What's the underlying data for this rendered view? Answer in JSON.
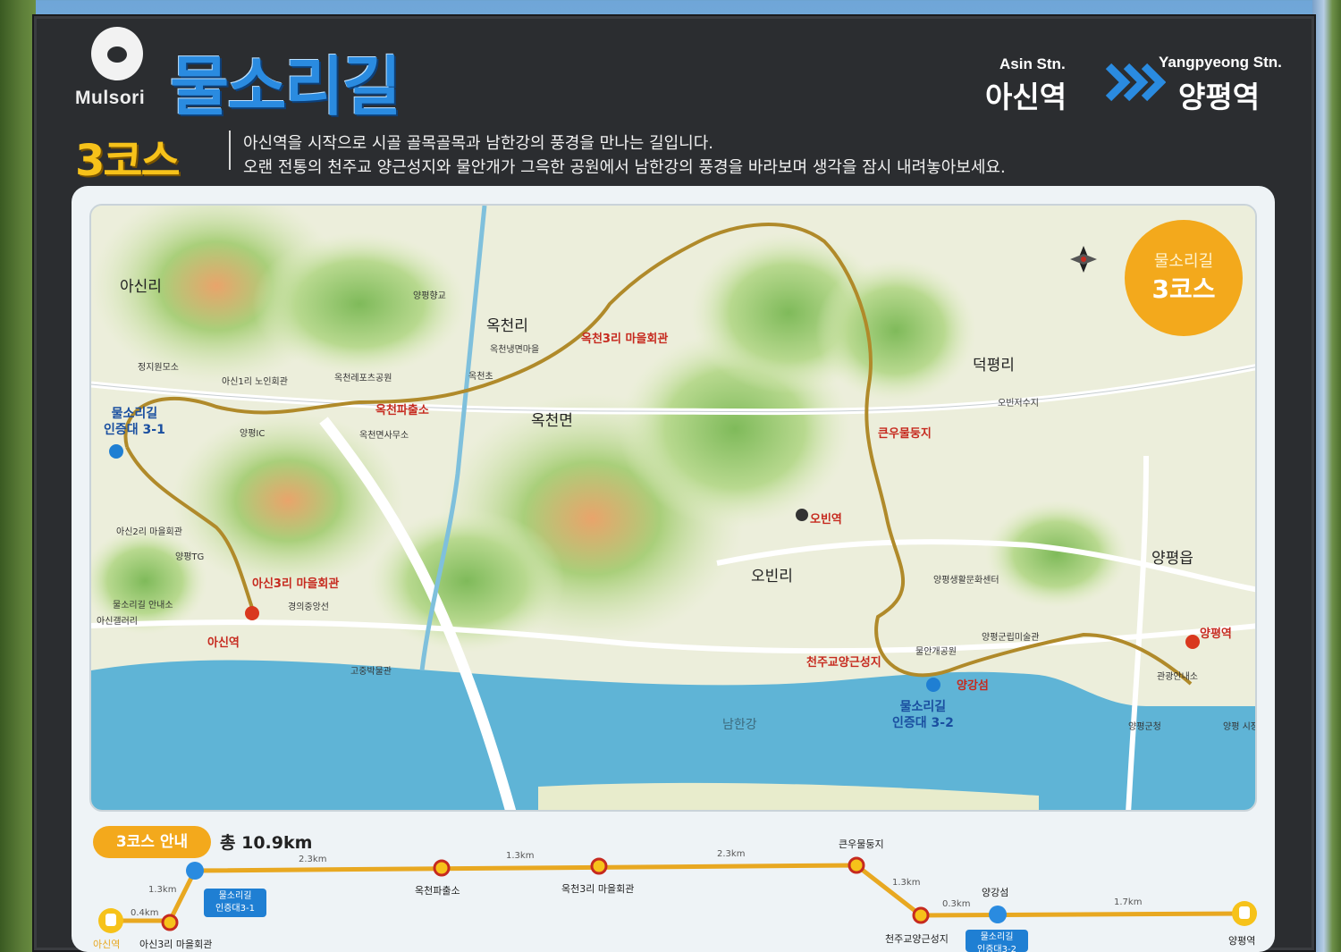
{
  "header": {
    "logo_text": "Mulsori",
    "title": "물소리길",
    "course": "3코스",
    "from_en": "Asin Stn.",
    "from_ko": "아신역",
    "to_en": "Yangpyeong Stn.",
    "to_ko": "양평역",
    "desc_line1": "아신역을 시작으로 시골 골목골목과 남한강의 풍경을 만나는 길입니다.",
    "desc_line2": "오랜 전통의 천주교 양근성지와 물안개가 그윽한 공원에서 남한강의 풍경을 바라보며 생각을 잠시 내려놓아보세요."
  },
  "colors": {
    "board": "#2b2d30",
    "title_blue": "#2a8be0",
    "course_yellow": "#f6c21a",
    "trail": "#b08a2a",
    "river": "#5fb4d6",
    "badge": "#f3a91c",
    "station_red": "#d9381e"
  },
  "map": {
    "badge_line1": "물소리길",
    "badge_line2": "3코스",
    "towns": {
      "asinri": "아신리",
      "okcheonri": "옥천리",
      "okcheonmyeon": "옥천면",
      "deokpyeongri": "덕평리",
      "obinri": "오빈리",
      "yangpyeongeup": "양평읍"
    },
    "river_name": "남한강",
    "red_labels": {
      "okcheon_police": "옥천파출소",
      "okcheon3ri_hall": "옥천3리 마을회관",
      "keunu_pond": "큰우물둥지",
      "asin3ri_hall": "아신3리 마을회관",
      "asin_station": "아신역",
      "catholic_shrine": "천주교양근성지",
      "yangpyeong_station": "양평역",
      "obin_station": "오빈역",
      "yanggang_island": "양강섬"
    },
    "cert_1_line1": "물소리길",
    "cert_1_line2": "인증대 3-1",
    "cert_2_line1": "물소리길",
    "cert_2_line2": "인증대 3-2",
    "small_labels": {
      "jeongji": "정지원모소",
      "asin1ri": "아신1리 노인회관",
      "okcheon_sports": "옥천레포츠공원",
      "okcheon_office": "옥천면사무소",
      "okcheon_naengmyeon": "옥천냉면마을",
      "okcheon_elem": "옥천초",
      "yangpyeong_ic": "양평IC",
      "asin2ri": "아신2리 마을회관",
      "yangpyeong_tg": "양평TG",
      "mulsori_info": "물소리길 안내소",
      "asin_cafe": "아신갤러리",
      "gyeongui_line": "경의중앙선",
      "yangpyeong_center": "양평생활문화센터",
      "yangpyeong_museum": "양평군립미술관",
      "mulangae_park": "물안개공원",
      "tourist_info": "관광안내소",
      "yangpyeong_market": "양평 시장",
      "yangpyeong_office": "양평군청",
      "gojung": "고중박물관",
      "obin_reservoir": "오빈저수지",
      "yangpyeong_school": "양평향교"
    }
  },
  "strip": {
    "pill": "3코스 안내",
    "total": "총 10.9km",
    "stops": [
      {
        "name": "아신역",
        "dist": ""
      },
      {
        "name": "아신3리 마을회관",
        "dist": "0.4km"
      },
      {
        "name": "",
        "dist": "1.3km"
      },
      {
        "name": "옥천파출소",
        "dist": "2.3km"
      },
      {
        "name": "옥천3리 마을회관",
        "dist": "1.3km"
      },
      {
        "name": "큰우물둥지",
        "dist": "2.3km"
      },
      {
        "name": "천주교양근성지",
        "dist": "1.3km"
      },
      {
        "name": "양강섬",
        "dist": "0.3km"
      },
      {
        "name": "양평역",
        "dist": "1.7km"
      }
    ],
    "cert_1_line1": "물소리길",
    "cert_1_line2": "인증대3-1",
    "cert_2_line1": "물소리길",
    "cert_2_line2": "인증대3-2"
  }
}
